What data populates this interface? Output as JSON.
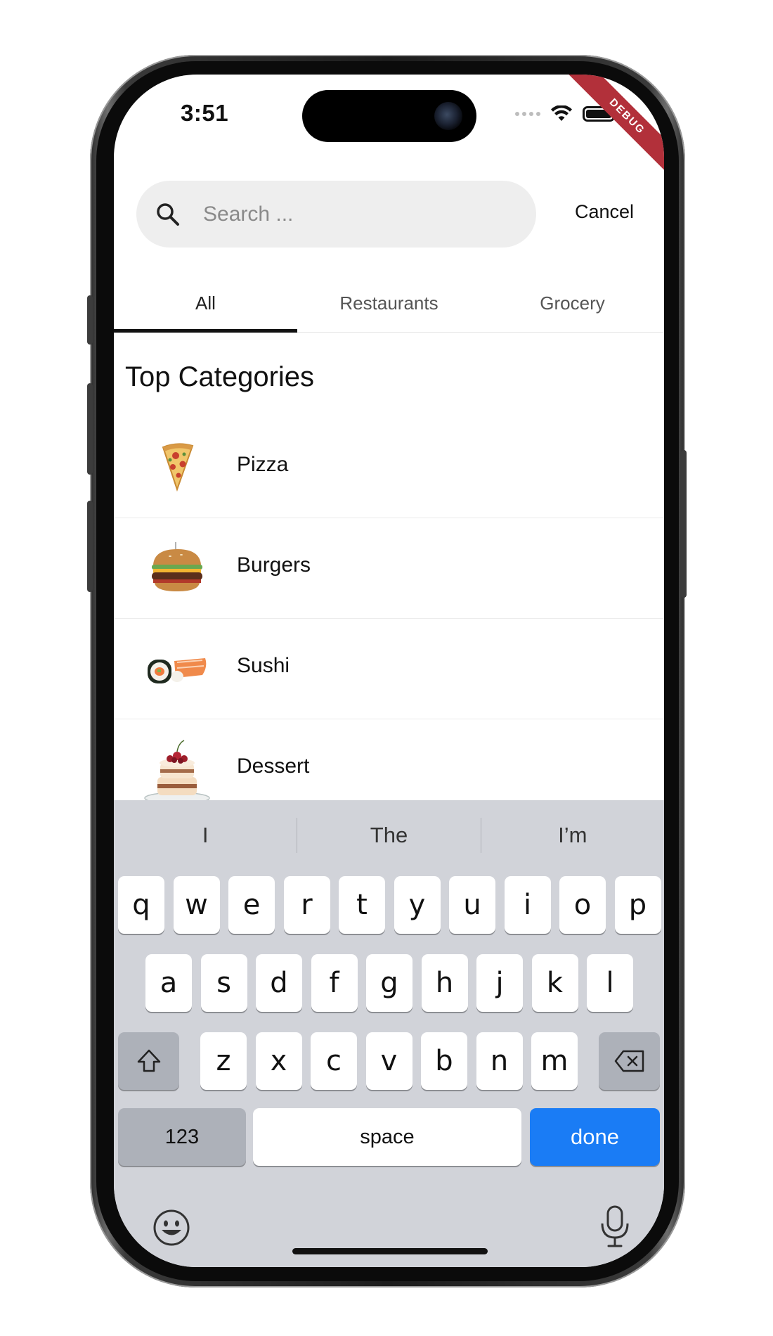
{
  "status_bar": {
    "time": "3:51",
    "debug_label": "DEBUG"
  },
  "search": {
    "placeholder": "Search ...",
    "value": "",
    "cancel_label": "Cancel"
  },
  "tabs": [
    {
      "label": "All",
      "active": true
    },
    {
      "label": "Restaurants",
      "active": false
    },
    {
      "label": "Grocery",
      "active": false
    }
  ],
  "section_title": "Top Categories",
  "categories": [
    {
      "label": "Pizza",
      "icon": "pizza-icon"
    },
    {
      "label": "Burgers",
      "icon": "burger-icon"
    },
    {
      "label": "Sushi",
      "icon": "sushi-icon"
    },
    {
      "label": "Dessert",
      "icon": "cake-icon"
    }
  ],
  "keyboard": {
    "suggestions": [
      "I",
      "The",
      "I’m"
    ],
    "row1": [
      "q",
      "w",
      "e",
      "r",
      "t",
      "y",
      "u",
      "i",
      "o",
      "p"
    ],
    "row2": [
      "a",
      "s",
      "d",
      "f",
      "g",
      "h",
      "j",
      "k",
      "l"
    ],
    "row3": [
      "z",
      "x",
      "c",
      "v",
      "b",
      "n",
      "m"
    ],
    "numbers_label": "123",
    "space_label": "space",
    "done_label": "done"
  },
  "colors": {
    "accent": "#1a7cf5",
    "debug": "#b2303a",
    "keyboard_bg": "#d1d3d9"
  }
}
